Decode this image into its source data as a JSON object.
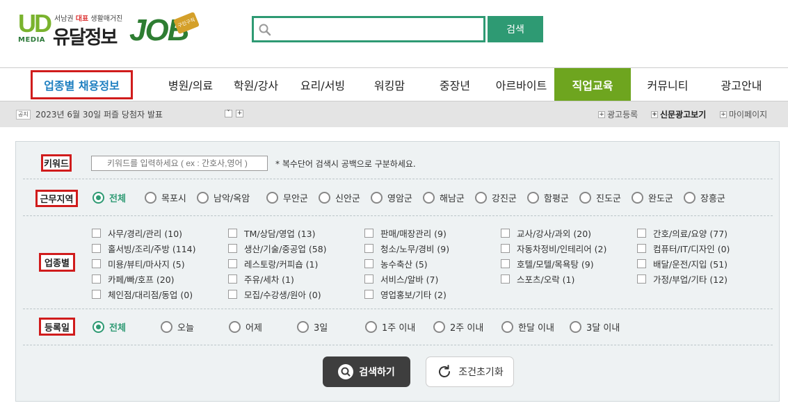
{
  "header": {
    "logo": {
      "ud": "UD",
      "media": "MEDIA",
      "tagline_pre": "서남권 ",
      "tagline_em": "대표",
      "tagline_post": " 생활매거진",
      "brand": "유달정보",
      "job": "JOB",
      "badge": "구인구직"
    },
    "search": {
      "placeholder": "",
      "value": "",
      "button": "검색"
    }
  },
  "nav": {
    "items": [
      {
        "label": "업종별 채용정보"
      },
      {
        "label": "병원/의료"
      },
      {
        "label": "학원/강사"
      },
      {
        "label": "요리/서빙"
      },
      {
        "label": "워킹맘"
      },
      {
        "label": "중장년"
      },
      {
        "label": "아르바이트"
      },
      {
        "label": "직업교육"
      },
      {
        "label": "커뮤니티"
      },
      {
        "label": "광고안내"
      }
    ]
  },
  "notice": {
    "tag": "공지",
    "text": "2023년 6월 30일 퍼즐 당첨자 발표",
    "down": "˅",
    "plus": "+",
    "links": [
      {
        "label": "광고등록"
      },
      {
        "label": "신문광고보기"
      },
      {
        "label": "마이페이지"
      }
    ]
  },
  "filters": {
    "keyword": {
      "label": "키워드",
      "placeholder": "키워드를 입력하세요 ( ex : 간호사,영어 )",
      "note": "* 복수단어 검색시 공백으로 구분하세요."
    },
    "region": {
      "label": "근무지역",
      "options": [
        "전체",
        "목포시",
        "남악/옥암",
        "무안군",
        "신안군",
        "영암군",
        "해남군",
        "강진군",
        "함평군",
        "진도군",
        "완도군",
        "장흥군"
      ],
      "selected": "전체"
    },
    "industry": {
      "label": "업종별",
      "columns": [
        [
          "사무/경리/관리 (10)",
          "홀서빙/조리/주방 (114)",
          "미용/뷰티/마사지 (5)",
          "카페/빠/호프 (20)",
          "체인점/대리점/동업 (0)"
        ],
        [
          "TM/상담/영업 (13)",
          "생산/기술/중공업 (58)",
          "레스토랑/커피숍 (1)",
          "주유/세차 (1)",
          "모집/수강생/원아 (0)"
        ],
        [
          "판매/매장관리 (9)",
          "청소/노무/경비 (9)",
          "농수축산 (5)",
          "서비스/알바 (7)",
          "영업홍보/기타 (2)"
        ],
        [
          "교사/강사/과외 (20)",
          "자동차정비/인테리어 (2)",
          "호텔/모텔/목욕탕 (9)",
          "스포츠/오락 (1)"
        ],
        [
          "간호/의료/요양 (77)",
          "컴퓨터/IT/디자인 (0)",
          "배달/운전/지입 (51)",
          "가정/부업/기타 (12)"
        ]
      ]
    },
    "date": {
      "label": "등록일",
      "options": [
        "전체",
        "오늘",
        "어제",
        "3일",
        "1주 이내",
        "2주 이내",
        "한달 이내",
        "3달 이내"
      ],
      "selected": "전체"
    }
  },
  "actions": {
    "search": "검색하기",
    "reset": "조건초기화"
  },
  "colors": {
    "brand_green": "#2e9a73",
    "nav_active": "#6ea51f",
    "highlight_red": "#d01c1c"
  }
}
